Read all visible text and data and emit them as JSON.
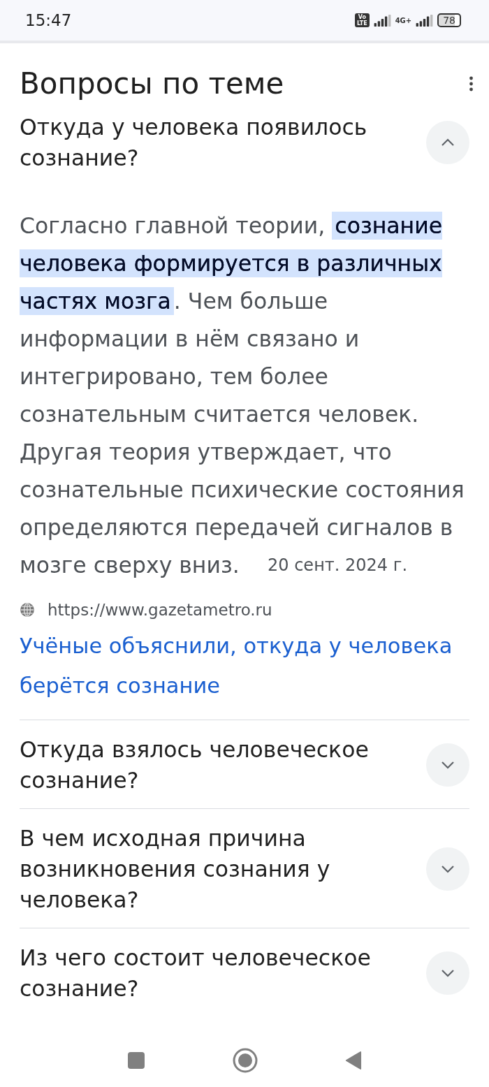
{
  "status_bar": {
    "time": "15:47",
    "volte": "Vo\nLTE",
    "network": "4G+",
    "battery": "78"
  },
  "section": {
    "title": "Вопросы по теме"
  },
  "questions": [
    {
      "question": "Откуда у человека появилось сознание?",
      "expanded": true,
      "answer": "Согласно главной теории, **сознание человека формируется в различных частях мозга**. Чем больше информации в нём связано и интегрировано, тем более сознательным считается человек. Другая теория утверждает, что сознательные психические состояния определяются передачей сигналов в мозге сверху вниз.",
      "date": "20 сент. 2024 г.",
      "source": "https://www.gazetametro.ru",
      "link": "Учёные объяснили, откуда у человека берётся сознание"
    },
    {
      "question": "Откуда взялось человеческое сознание?",
      "expanded": false
    },
    {
      "question": "В чем исходная причина возникновения сознания у человека?",
      "expanded": false
    },
    {
      "question": "Из чего состоит человеческое сознание?",
      "expanded": false
    }
  ]
}
